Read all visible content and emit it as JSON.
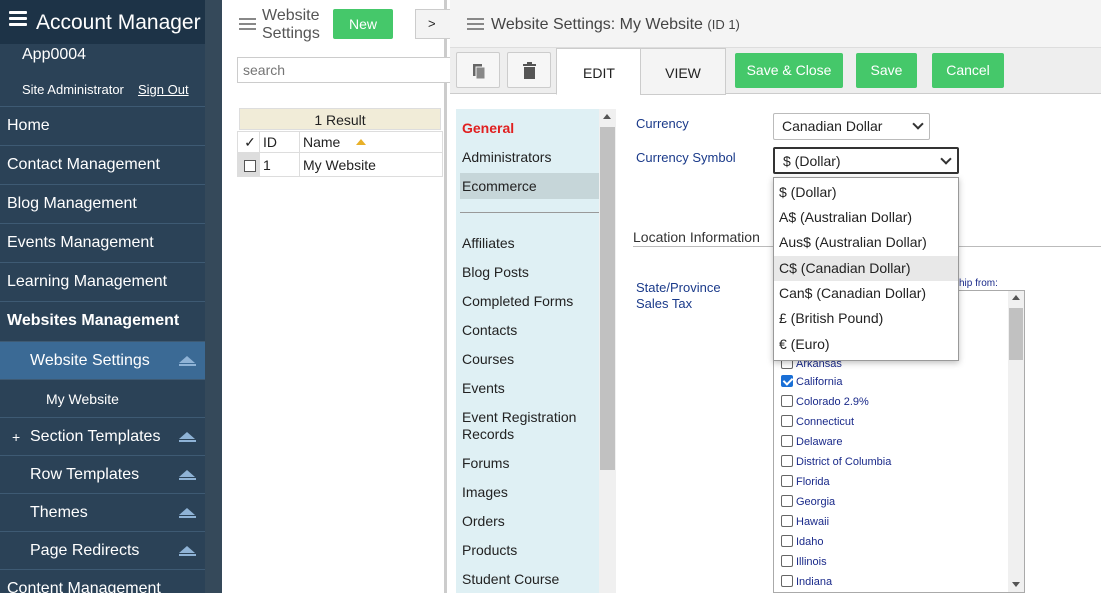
{
  "nav": {
    "app_title": "Account Manager",
    "app_id": "App0004",
    "role": "Site Administrator",
    "sign_out": "Sign Out",
    "items": [
      {
        "label": "Home"
      },
      {
        "label": "Contact Management"
      },
      {
        "label": "Blog Management"
      },
      {
        "label": "Events Management"
      },
      {
        "label": "Learning Management"
      },
      {
        "label": "Websites Management"
      },
      {
        "label": "Website Settings"
      },
      {
        "label": "My Website"
      },
      {
        "label": "Section Templates",
        "prefix": "+"
      },
      {
        "label": "Row Templates"
      },
      {
        "label": "Themes"
      },
      {
        "label": "Page Redirects"
      },
      {
        "label": "Content Management"
      }
    ]
  },
  "list": {
    "title": "Website Settings",
    "new_label": "New",
    "expand_label": ">",
    "search_placeholder": "search",
    "result_count": "1 Result",
    "columns": {
      "check": "✓",
      "id": "ID",
      "name": "Name"
    },
    "rows": [
      {
        "id": "1",
        "name": "My Website"
      }
    ]
  },
  "main": {
    "title": "Website Settings: My Website",
    "title_id": "(ID 1)",
    "tabs": {
      "edit": "EDIT",
      "view": "VIEW"
    },
    "buttons": {
      "save_close": "Save & Close",
      "save": "Save",
      "cancel": "Cancel"
    },
    "sidepanel": {
      "items": [
        "General",
        "Administrators",
        "Ecommerce",
        "Affiliates",
        "Blog Posts",
        "Completed Forms",
        "Contacts",
        "Courses",
        "Events",
        "Event Registration Records",
        "Forums",
        "Images",
        "Orders",
        "Products",
        "Student Course"
      ]
    },
    "form": {
      "currency_label": "Currency",
      "currency_value": "Canadian Dollar",
      "symbol_label": "Currency Symbol",
      "symbol_value": "$ (Dollar)",
      "location_section": "Location Information",
      "sales_tax_label": "State/Province Sales Tax",
      "ship_from_fragment": "ship from:"
    },
    "symbol_options": [
      "$ (Dollar)",
      "A$ (Australian Dollar)",
      "Aus$ (Australian Dollar)",
      "C$ (Canadian Dollar)",
      "Can$ (Canadian Dollar)",
      "£ (British Pound)",
      "€ (Euro)"
    ],
    "highlighted_option": "C$ (Canadian Dollar)",
    "states": [
      {
        "name": "Arkansas",
        "checked": false
      },
      {
        "name": "California",
        "checked": true
      },
      {
        "name": "Colorado 2.9%",
        "checked": false
      },
      {
        "name": "Connecticut",
        "checked": false
      },
      {
        "name": "Delaware",
        "checked": false
      },
      {
        "name": "District of Columbia",
        "checked": false
      },
      {
        "name": "Florida",
        "checked": false
      },
      {
        "name": "Georgia",
        "checked": false
      },
      {
        "name": "Hawaii",
        "checked": false
      },
      {
        "name": "Idaho",
        "checked": false
      },
      {
        "name": "Illinois",
        "checked": false
      },
      {
        "name": "Indiana",
        "checked": false
      }
    ]
  },
  "colors": {
    "nav_bg": "#2b4257",
    "accent_green": "#45c86a",
    "active_blue": "#3b6a95",
    "label_blue": "#1a3a8a"
  }
}
